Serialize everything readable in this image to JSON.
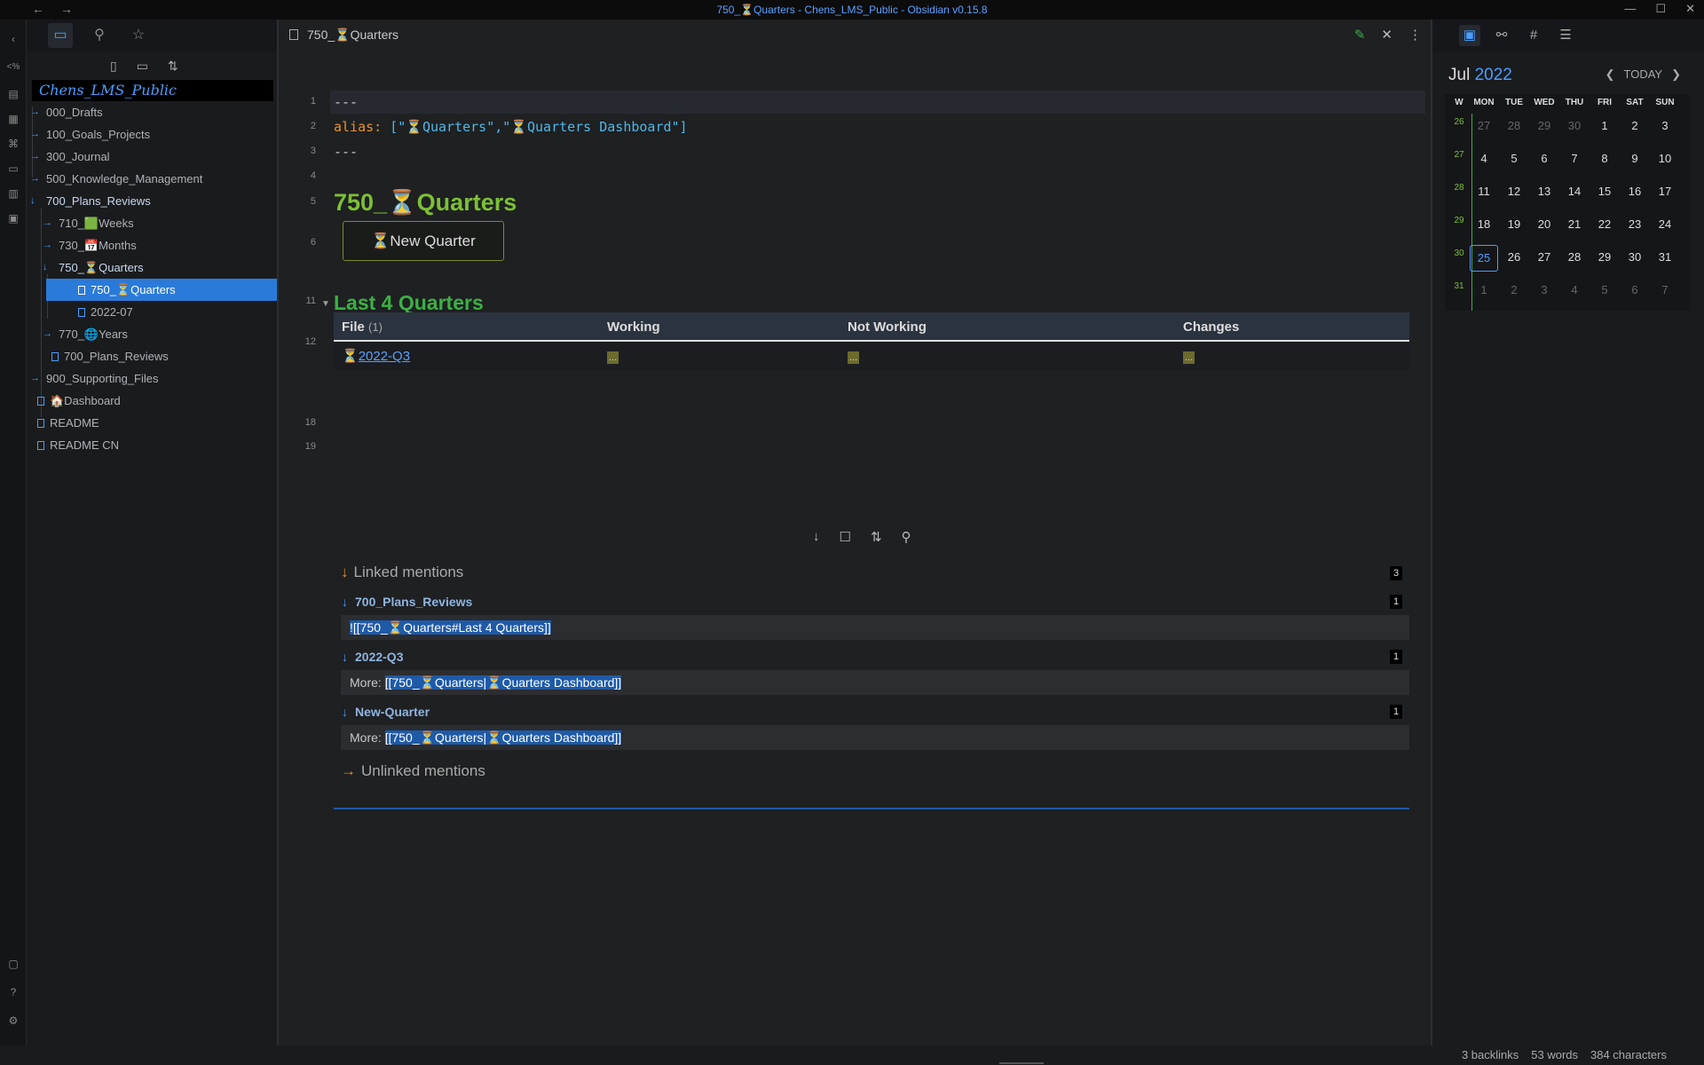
{
  "window": {
    "title": "750_⏳Quarters - Chens_LMS_Public - Obsidian v0.15.8",
    "back": "←",
    "forward": "→",
    "minimize": "—",
    "maximize": "☐",
    "close": "✕"
  },
  "sidebar": {
    "vault_name": "Chens_LMS_Public",
    "tree": [
      {
        "label": "000_Drafts",
        "type": "folder",
        "expanded": false
      },
      {
        "label": "100_Goals_Projects",
        "type": "folder",
        "expanded": false
      },
      {
        "label": "300_Journal",
        "type": "folder",
        "expanded": false
      },
      {
        "label": "500_Knowledge_Management",
        "type": "folder",
        "expanded": false
      },
      {
        "label": "700_Plans_Reviews",
        "type": "folder",
        "expanded": true
      },
      {
        "label": "710_🟩Weeks",
        "type": "folder",
        "expanded": false
      },
      {
        "label": "730_📅Months",
        "type": "folder",
        "expanded": false
      },
      {
        "label": "750_⏳Quarters",
        "type": "folder",
        "expanded": true
      },
      {
        "label": "750_⏳Quarters",
        "type": "file",
        "selected": true
      },
      {
        "label": "2022-07",
        "type": "file"
      },
      {
        "label": "770_🌐Years",
        "type": "folder",
        "expanded": false
      },
      {
        "label": "700_Plans_Reviews",
        "type": "file"
      },
      {
        "label": "900_Supporting_Files",
        "type": "folder",
        "expanded": false
      },
      {
        "label": "🏠Dashboard",
        "type": "file"
      },
      {
        "label": "README",
        "type": "file"
      },
      {
        "label": "README CN",
        "type": "file"
      }
    ]
  },
  "editor": {
    "tab_title": "750_⏳Quarters",
    "line_numbers": [
      "1",
      "2",
      "3",
      "4",
      "5",
      "6",
      "11",
      "12",
      "18",
      "19"
    ],
    "frontmatter": {
      "delim": "---",
      "alias_key": "alias:",
      "alias_value": " [\"⏳Quarters\",\"⏳Quarters Dashboard\"]"
    },
    "heading1": "750_⏳Quarters",
    "button_label": "⏳New Quarter",
    "heading2": "Last 4 Quarters",
    "table": {
      "headers": [
        "File",
        "Working",
        "Not Working",
        "Changes"
      ],
      "file_count": "(1)",
      "rows": [
        {
          "file": "2022-Q3",
          "file_prefix": "⏳",
          "working": "...",
          "not_working": "...",
          "changes": "..."
        }
      ]
    }
  },
  "backlinks": {
    "linked_title": "Linked mentions",
    "linked_count": "3",
    "groups": [
      {
        "name": "700_Plans_Reviews",
        "count": "1",
        "prefix": "",
        "text": "![[750_⏳Quarters#Last 4 Quarters]]"
      },
      {
        "name": "2022-Q3",
        "count": "1",
        "prefix": "More: ",
        "text": "[[750_⏳Quarters|⏳Quarters Dashboard]]"
      },
      {
        "name": "New-Quarter",
        "count": "1",
        "prefix": "More: ",
        "text": "[[750_⏳Quarters|⏳Quarters Dashboard]]"
      }
    ],
    "unlinked_title": "Unlinked mentions"
  },
  "calendar": {
    "month": "Jul",
    "year": "2022",
    "today_label": "TODAY",
    "weekday_headers": [
      "W",
      "MON",
      "TUE",
      "WED",
      "THU",
      "FRI",
      "SAT",
      "SUN"
    ],
    "weeks": [
      {
        "wn": "26",
        "days": [
          "27",
          "28",
          "29",
          "30",
          "1",
          "2",
          "3"
        ],
        "dim": [
          true,
          true,
          true,
          true,
          false,
          false,
          false
        ]
      },
      {
        "wn": "27",
        "days": [
          "4",
          "5",
          "6",
          "7",
          "8",
          "9",
          "10"
        ],
        "dim": [
          false,
          false,
          false,
          false,
          false,
          false,
          false
        ]
      },
      {
        "wn": "28",
        "days": [
          "11",
          "12",
          "13",
          "14",
          "15",
          "16",
          "17"
        ],
        "dim": [
          false,
          false,
          false,
          false,
          false,
          false,
          false
        ]
      },
      {
        "wn": "29",
        "days": [
          "18",
          "19",
          "20",
          "21",
          "22",
          "23",
          "24"
        ],
        "dim": [
          false,
          false,
          false,
          false,
          false,
          false,
          false
        ]
      },
      {
        "wn": "30",
        "days": [
          "25",
          "26",
          "27",
          "28",
          "29",
          "30",
          "31"
        ],
        "dim": [
          false,
          false,
          false,
          false,
          false,
          false,
          false
        ],
        "today_index": 0
      },
      {
        "wn": "31",
        "days": [
          "1",
          "2",
          "3",
          "4",
          "5",
          "6",
          "7"
        ],
        "dim": [
          true,
          true,
          true,
          true,
          true,
          true,
          true
        ]
      }
    ]
  },
  "status": {
    "backlinks": "3 backlinks",
    "words": "53 words",
    "characters": "384 characters"
  },
  "colors": {
    "accent": "#4a9eff",
    "heading1": "#7cc035",
    "heading2": "#3cb043",
    "selection": "#2a7ad9"
  }
}
